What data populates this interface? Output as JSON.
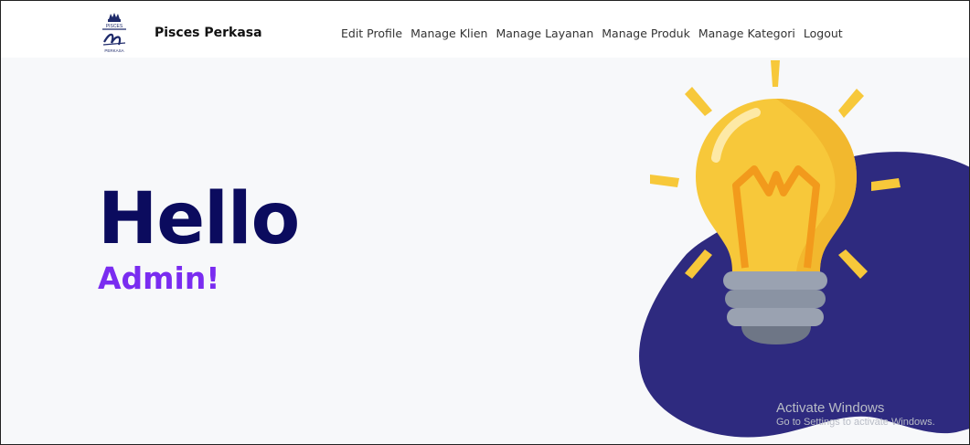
{
  "app": {
    "brand": "Pisces Perkasa",
    "logo_text_top": "PISCES",
    "logo_text_bottom": "PERKASA"
  },
  "nav": {
    "links": [
      {
        "label": "Edit Profile"
      },
      {
        "label": "Manage Klien"
      },
      {
        "label": "Manage Layanan"
      },
      {
        "label": "Manage Produk"
      },
      {
        "label": "Manage Kategori"
      },
      {
        "label": "Logout"
      }
    ]
  },
  "hero": {
    "title": "Hello",
    "subtitle": "Admin!"
  },
  "watermark": {
    "title": "Activate Windows",
    "subtitle": "Go to Settings to activate Windows."
  },
  "colors": {
    "title": "#0b0b5e",
    "subtitle": "#7a2cf0",
    "blob": "#2e2a7f",
    "bulb": "#f7c83a",
    "filament": "#f29a1c",
    "base": "#8a93a3"
  },
  "icons": {
    "logo": "pisces-perkasa-logo",
    "illustration": "lightbulb-illustration"
  }
}
